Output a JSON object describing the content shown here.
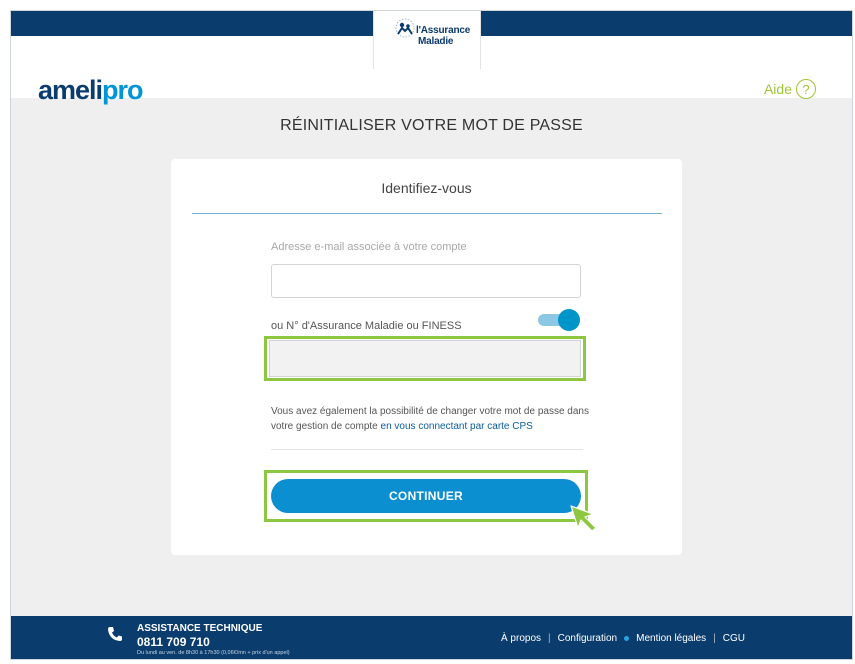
{
  "header": {
    "assurance_line1": "l'Assurance",
    "assurance_line2": "Maladie",
    "brand_part1": "ameli",
    "brand_part2": "pro",
    "help_label": "Aide",
    "help_icon_glyph": "?"
  },
  "page": {
    "title": "RÉINITIALISER VOTRE MOT DE PASSE"
  },
  "form": {
    "card_title": "Identifiez-vous",
    "email_label": "Adresse e-mail associée à votre compte",
    "email_value": "",
    "id_label": "ou N° d'Assurance Maladie ou FINESS",
    "id_value": "",
    "toggle_on": true,
    "info_text": "Vous avez également la possibilité de changer votre mot de passe dans votre gestion de compte ",
    "info_link": "en vous connectant par carte CPS",
    "submit_label": "CONTINUER"
  },
  "footer": {
    "assist_title": "ASSISTANCE TECHNIQUE",
    "phone": "0811 709 710",
    "hours": "Du lundi au ven. de 8h30 à 17h30 (0,06€/mn + prix d'un appel)",
    "link_about": "À propos",
    "link_config": "Configuration",
    "link_legal": "Mention légales",
    "link_cgu": "CGU",
    "sep": "|"
  },
  "colors": {
    "navy": "#0b3c6e",
    "brand_blue": "#0095d6",
    "button_blue": "#0b8fd0",
    "highlight_green": "#8dc63f",
    "help_green": "#a0c43a"
  }
}
